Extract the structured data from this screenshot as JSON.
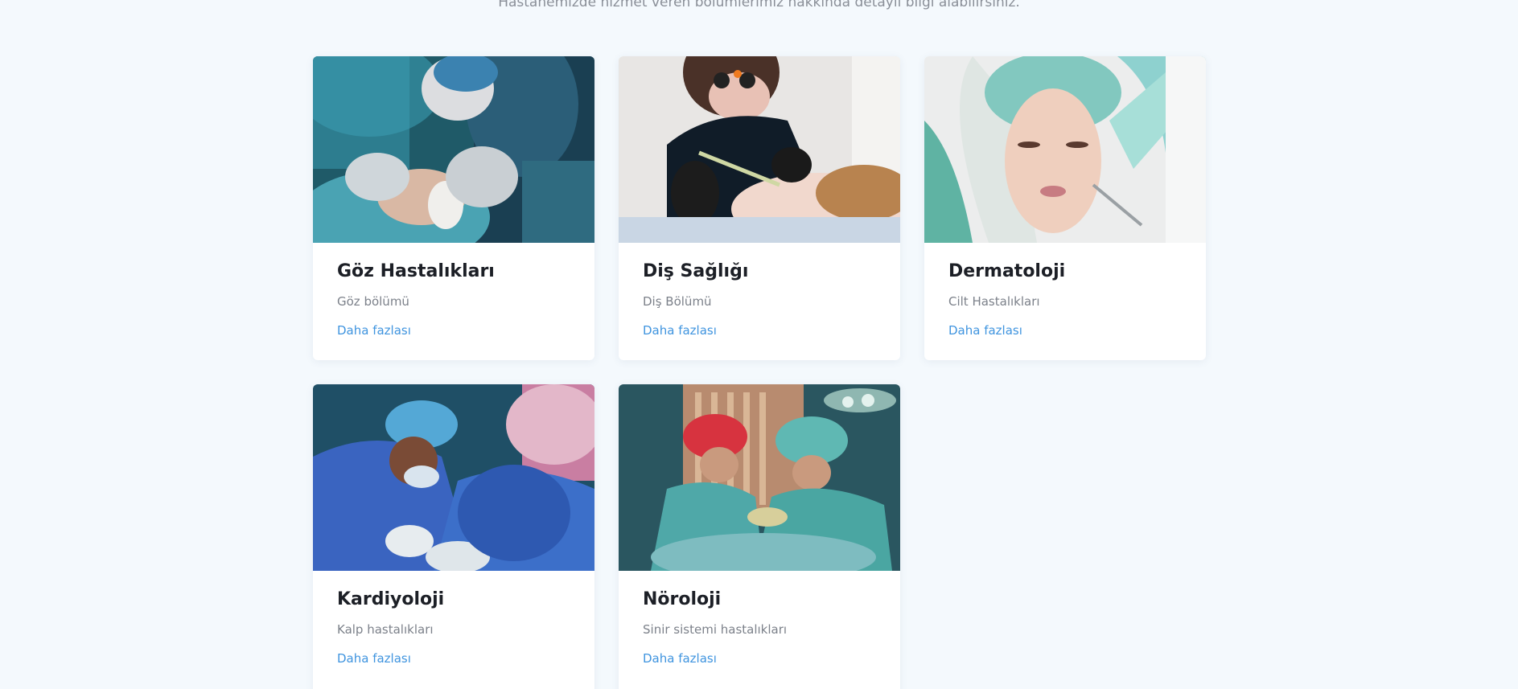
{
  "section": {
    "subtitle": "Hastanemizde hizmet veren bölümlerimiz hakkında detaylı bilgi alabilirsiniz."
  },
  "departments": [
    {
      "title": "Göz Hastalıkları",
      "description": "Göz bölümü",
      "link": "Daha fazlası",
      "image_icon": "eye-surgery-photo"
    },
    {
      "title": "Diş Sağlığı",
      "description": "Diş Bölümü",
      "link": "Daha fazlası",
      "image_icon": "dental-photo"
    },
    {
      "title": "Dermatoloji",
      "description": "Cilt Hastalıkları",
      "link": "Daha fazlası",
      "image_icon": "skincare-photo"
    },
    {
      "title": "Kardiyoloji",
      "description": "Kalp hastalıkları",
      "link": "Daha fazlası",
      "image_icon": "cardio-surgery-photo"
    },
    {
      "title": "Nöroloji",
      "description": "Sinir sistemi hastalıkları",
      "link": "Daha fazlası",
      "image_icon": "neuro-surgery-photo"
    }
  ],
  "colors": {
    "background": "#f4f9fd",
    "card": "#ffffff",
    "title": "#1c1f26",
    "description": "#7c818a",
    "link": "#3f94df"
  }
}
